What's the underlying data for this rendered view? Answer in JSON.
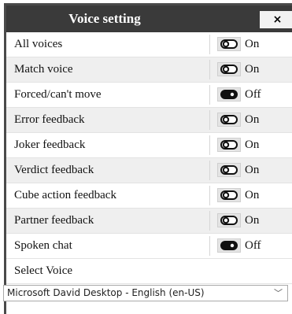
{
  "dialog": {
    "title": "Voice setting",
    "close_label": "×"
  },
  "settings": [
    {
      "label": "All voices",
      "state": "On"
    },
    {
      "label": "Match voice",
      "state": "On"
    },
    {
      "label": "Forced/can't move",
      "state": "Off"
    },
    {
      "label": "Error feedback",
      "state": "On"
    },
    {
      "label": "Joker feedback",
      "state": "On"
    },
    {
      "label": "Verdict feedback",
      "state": "On"
    },
    {
      "label": "Cube action feedback",
      "state": "On"
    },
    {
      "label": "Partner feedback",
      "state": "On"
    },
    {
      "label": "Spoken chat",
      "state": "Off"
    }
  ],
  "voice": {
    "label": "Select Voice",
    "selected": "Microsoft David Desktop - English (en-US)"
  }
}
